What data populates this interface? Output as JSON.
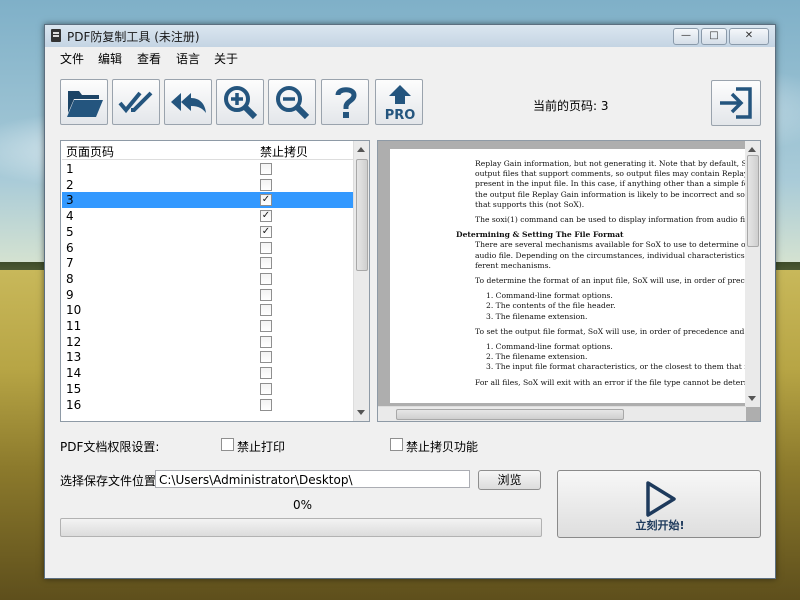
{
  "window": {
    "title": "PDF防复制工具 (未注册)",
    "controls": [
      "minimize",
      "maximize",
      "close"
    ]
  },
  "menu": [
    "文件",
    "编辑",
    "查看",
    "语言",
    "关于"
  ],
  "toolbar": {
    "buttons": [
      {
        "name": "open-folder",
        "icon": "folder-icon"
      },
      {
        "name": "check-all",
        "icon": "double-check-icon"
      },
      {
        "name": "undo",
        "icon": "reply-all-icon"
      },
      {
        "name": "zoom-in",
        "icon": "zoom-in-icon"
      },
      {
        "name": "zoom-out",
        "icon": "zoom-out-icon"
      },
      {
        "name": "help",
        "icon": "question-icon"
      },
      {
        "name": "upgrade",
        "icon": "pro-upgrade-icon",
        "text": "PRO"
      }
    ],
    "current_page_label": "当前的页码: 3",
    "exit_icon": "exit-icon"
  },
  "table": {
    "headers": [
      "页面页码",
      "禁止拷贝"
    ],
    "rows": [
      {
        "page": "1",
        "checked": false,
        "selected": false
      },
      {
        "page": "2",
        "checked": false,
        "selected": false
      },
      {
        "page": "3",
        "checked": true,
        "selected": true
      },
      {
        "page": "4",
        "checked": true,
        "selected": false
      },
      {
        "page": "5",
        "checked": true,
        "selected": false
      },
      {
        "page": "6",
        "checked": false,
        "selected": false
      },
      {
        "page": "7",
        "checked": false,
        "selected": false
      },
      {
        "page": "8",
        "checked": false,
        "selected": false
      },
      {
        "page": "9",
        "checked": false,
        "selected": false
      },
      {
        "page": "10",
        "checked": false,
        "selected": false
      },
      {
        "page": "11",
        "checked": false,
        "selected": false
      },
      {
        "page": "12",
        "checked": false,
        "selected": false
      },
      {
        "page": "13",
        "checked": false,
        "selected": false
      },
      {
        "page": "14",
        "checked": false,
        "selected": false
      },
      {
        "page": "15",
        "checked": false,
        "selected": false
      },
      {
        "page": "16",
        "checked": false,
        "selected": false
      }
    ]
  },
  "preview": {
    "lines": [
      {
        "text": "Replay Gain information, but not generating it.  Note that by default, SoX c",
        "indent": true
      },
      {
        "text": "output files that support comments, so output files may contain Replay G",
        "indent": true
      },
      {
        "text": "present in the input file.  In this case, if anything other than a simple format c",
        "indent": true
      },
      {
        "text": "the output file Replay Gain information is likely to be incorrect and so shoul",
        "indent": true
      },
      {
        "text": "that supports this (not SoX).",
        "indent": true
      },
      {
        "text": "The soxi(1) command can be used to display information from audio file head",
        "indent": true
      },
      {
        "text": "Determining & Setting The File Format",
        "heading": true
      },
      {
        "text": "There are several mechanisms available for SoX to use to determine or set th",
        "indent": true
      },
      {
        "text": "audio file.  Depending on the circumstances, individual characteristics may b",
        "indent": true
      },
      {
        "text": "ferent mechanisms.",
        "indent": true
      },
      {
        "text": "To determine the format of an input file, SoX will use, in order of precedence",
        "indent": true
      },
      {
        "text": "1.      Command-line format options.",
        "list": true
      },
      {
        "text": "2.      The contents of the file header.",
        "list": true
      },
      {
        "text": "3.      The filename extension.",
        "list": true
      },
      {
        "text": "To set the output file format, SoX will use, in order of precedence and as give",
        "indent": true
      },
      {
        "text": "1.      Command-line format options.",
        "list": true
      },
      {
        "text": "2.      The filename extension.",
        "list": true
      },
      {
        "text": "3.      The input file format characteristics, or the closest to them that is sup",
        "list": true
      },
      {
        "text": "For all files, SoX will exit with an error if the file type cannot be determined;",
        "indent": true
      }
    ]
  },
  "settings": {
    "label": "PDF文档权限设置:",
    "disable_print": {
      "label": "禁止打印",
      "checked": false
    },
    "disable_copy": {
      "label": "禁止拷贝功能",
      "checked": false
    }
  },
  "save": {
    "label": "选择保存文件位置",
    "path": "C:\\Users\\Administrator\\Desktop\\",
    "browse_label": "浏览"
  },
  "progress": {
    "text": "0%",
    "value": 0
  },
  "start": {
    "label": "立刻开始!",
    "icon": "play-icon"
  }
}
